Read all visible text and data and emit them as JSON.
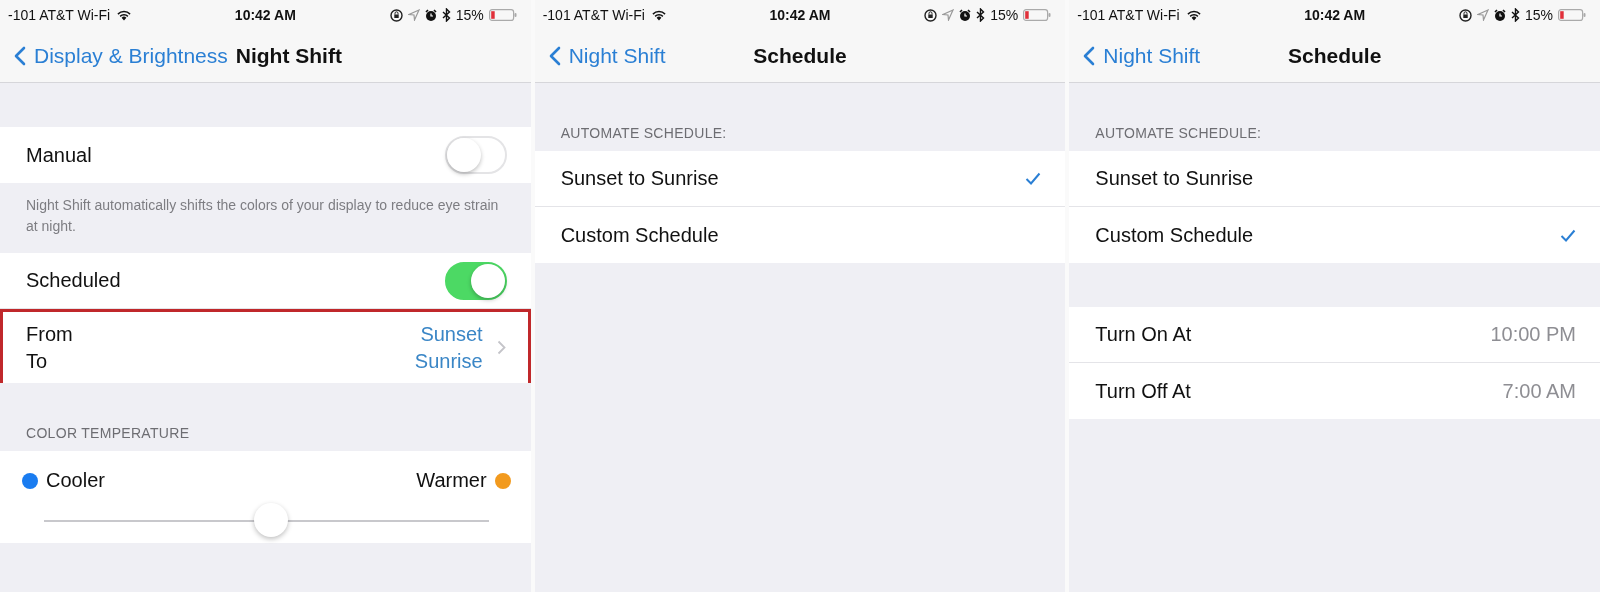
{
  "screens": [
    {
      "status_bar": {
        "carrier": "-101 AT&T Wi-Fi",
        "time": "10:42 AM",
        "battery": "15%"
      },
      "nav": {
        "back": "Display & Brightness",
        "title": "Night Shift"
      },
      "sections": [
        {
          "items": [
            {
              "kind": "toggle",
              "label": "Manual",
              "on": false
            }
          ],
          "footer": "Night Shift automatically shifts the colors of your display to reduce eye strain at night."
        },
        {
          "items": [
            {
              "kind": "toggle",
              "label": "Scheduled",
              "on": true
            },
            {
              "kind": "range",
              "from_label": "From",
              "to_label": "To",
              "from_value": "Sunset",
              "to_value": "Sunrise",
              "highlighted": true
            }
          ]
        },
        {
          "header": "COLOR TEMPERATURE",
          "items": [
            {
              "kind": "slider",
              "ends": [
                {
                  "label": "Cooler",
                  "color": "#1a7cf0"
                },
                {
                  "label": "Warmer",
                  "color": "#f29a1e"
                }
              ],
              "level": 0.51
            }
          ]
        }
      ]
    },
    {
      "status_bar": {
        "carrier": "-101 AT&T Wi-Fi",
        "time": "10:42 AM",
        "battery": "15%"
      },
      "nav": {
        "back": "Night Shift",
        "title": "Schedule"
      },
      "sections": [
        {
          "header": "AUTOMATE SCHEDULE:",
          "items": [
            {
              "kind": "option",
              "label": "Sunset to Sunrise",
              "selected": true
            },
            {
              "kind": "option",
              "label": "Custom Schedule",
              "selected": false
            }
          ]
        }
      ]
    },
    {
      "status_bar": {
        "carrier": "-101 AT&T Wi-Fi",
        "time": "10:42 AM",
        "battery": "15%"
      },
      "nav": {
        "back": "Night Shift",
        "title": "Schedule"
      },
      "sections": [
        {
          "header": "AUTOMATE SCHEDULE:",
          "items": [
            {
              "kind": "option",
              "label": "Sunset to Sunrise",
              "selected": false
            },
            {
              "kind": "option",
              "label": "Custom Schedule",
              "selected": true
            }
          ]
        },
        {
          "items": [
            {
              "kind": "detail",
              "label": "Turn On At",
              "value": "10:00 PM"
            },
            {
              "kind": "detail",
              "label": "Turn Off At",
              "value": "7:00 AM"
            }
          ]
        }
      ]
    }
  ]
}
